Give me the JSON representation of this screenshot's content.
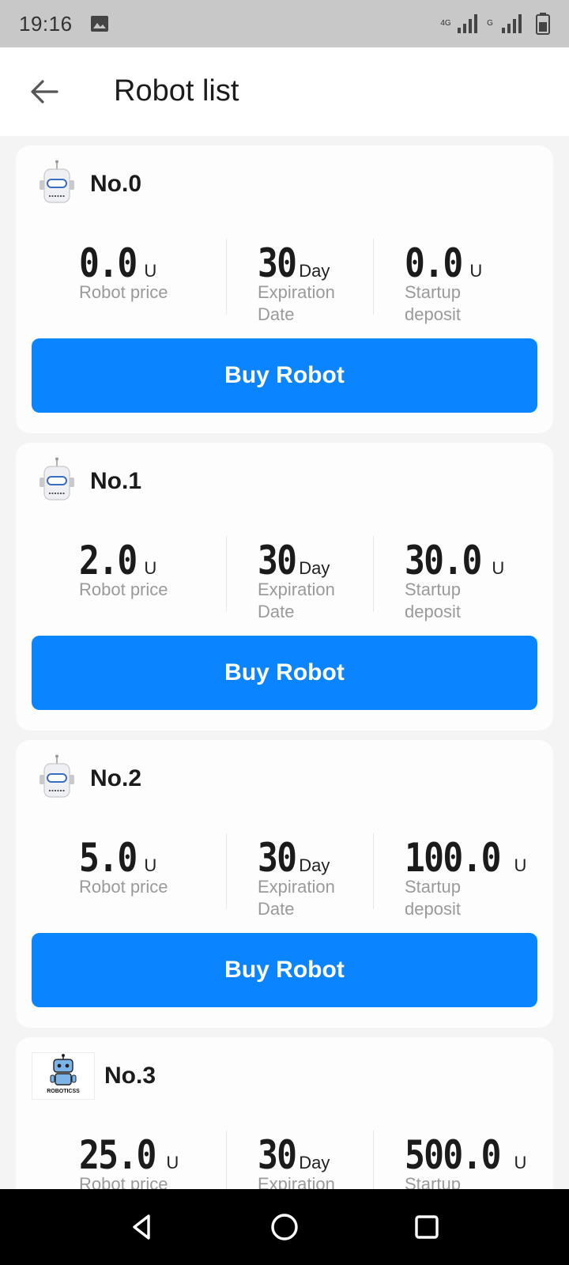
{
  "status_bar": {
    "time": "19:16",
    "network_label": "4G",
    "network_label_2": "G"
  },
  "header": {
    "title": "Robot list"
  },
  "labels": {
    "robot_price": "Robot price",
    "expiration_date": "Expiration Date",
    "startup_deposit": "Startup deposit",
    "buy_button": "Buy Robot",
    "unit_u": "U",
    "unit_day": "Day"
  },
  "robots": [
    {
      "name": "No.0",
      "price": "0.0",
      "days": "30",
      "deposit": "0.0"
    },
    {
      "name": "No.1",
      "price": "2.0",
      "days": "30",
      "deposit": "30.0"
    },
    {
      "name": "No.2",
      "price": "5.0",
      "days": "30",
      "deposit": "100.0"
    },
    {
      "name": "No.3",
      "price": "25.0",
      "days": "30",
      "deposit": "500.0",
      "logo_text": "ROBOTICSS"
    }
  ],
  "colors": {
    "accent": "#0a84ff",
    "status_bar": "#c8c8c8",
    "nav_bar": "#000000"
  },
  "icons": {
    "back": "arrow-left-icon",
    "robot": "robot-icon",
    "nav_back": "triangle-back-icon",
    "nav_home": "circle-home-icon",
    "nav_recent": "square-recent-icon"
  }
}
